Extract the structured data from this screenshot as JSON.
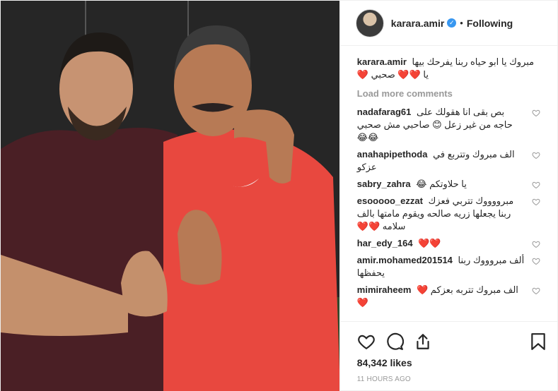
{
  "header": {
    "username": "karara.amir",
    "verified_glyph": "✓",
    "separator": "•",
    "follow_label": "Following"
  },
  "caption": {
    "author": "karara.amir",
    "text": "مبروك يا ابو حياه ربنا يفرحك بيها يا ❤️❤️ صحبي ❤️"
  },
  "load_more": "Load more comments",
  "comments": [
    {
      "author": "nadafarag61",
      "text": "بص بقى انا هقولك على حاجه من غير زعل 😊 صاحبي مش صحبي 😂😂"
    },
    {
      "author": "anahapipethoda",
      "text": "الف مبروك وتتربع في عزكو"
    },
    {
      "author": "sabry_zahra",
      "text": "يا حلاوتكم 😂"
    },
    {
      "author": "esooooo_ezzat",
      "text": "مبرووووك تتربي فعزك ربنا يجعلها زريه صالحه ويقوم مامتها بالف سلامه ❤️❤️"
    },
    {
      "author": "har_edy_164",
      "text": "❤️❤️"
    },
    {
      "author": "amir.mohamed201514",
      "text": "ألف مبروووك ربنا يحفظها"
    },
    {
      "author": "mimiraheem",
      "text": "الف مبروك تتربه بعزكم ❤️ ❤️"
    }
  ],
  "likes": "84,342 likes",
  "timestamp": "11 HOURS AGO",
  "icons": {
    "like": "heart-icon",
    "comment": "comment-icon",
    "share": "share-icon",
    "save": "bookmark-icon"
  },
  "colors": {
    "verified": "#3897f0",
    "heart": "#e0245e",
    "muted": "#999999"
  }
}
